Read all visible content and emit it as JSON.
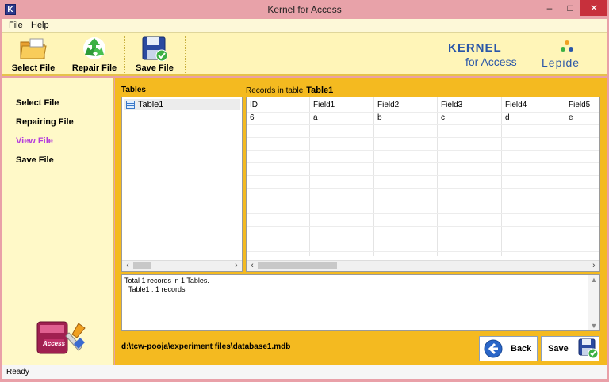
{
  "window": {
    "title": "Kernel for Access",
    "app_icon": "K",
    "minimize": "–",
    "maximize": "□",
    "close": "✕"
  },
  "menu": [
    {
      "label": "File"
    },
    {
      "label": "Help"
    }
  ],
  "toolbar": {
    "select_file": "Select File",
    "repair_file": "Repair File",
    "save_file": "Save File"
  },
  "brand": {
    "kernel": "KERNEL",
    "for_access": "for Access",
    "lepide": "Lepide"
  },
  "sidebar": {
    "items": [
      {
        "label": "Select File",
        "active": false
      },
      {
        "label": "Repairing File",
        "active": false
      },
      {
        "label": "View File",
        "active": true
      },
      {
        "label": "Save File",
        "active": false
      }
    ],
    "logo_text": "Access"
  },
  "tables_panel": {
    "header": "Tables",
    "items": [
      "Table1"
    ]
  },
  "records": {
    "header_prefix": "Records in table",
    "table_name": "Table1",
    "columns": [
      "ID",
      "Field1",
      "Field2",
      "Field3",
      "Field4",
      "Field5"
    ],
    "rows": [
      [
        "6",
        "a",
        "b",
        "c",
        "d",
        "e"
      ]
    ]
  },
  "log": {
    "lines": [
      "Total 1 records in 1 Tables.",
      "Table1 : 1 records"
    ]
  },
  "path": "d:\\tcw-pooja\\experiment files\\database1.mdb",
  "buttons": {
    "back": "Back",
    "save": "Save"
  },
  "status": "Ready",
  "colors": {
    "title_bar": "#e8a2a9",
    "toolbar_bg": "#fff5b8",
    "main_bg": "#f4ba20",
    "active_nav": "#b43cdc",
    "brand_blue": "#2a56a8"
  }
}
